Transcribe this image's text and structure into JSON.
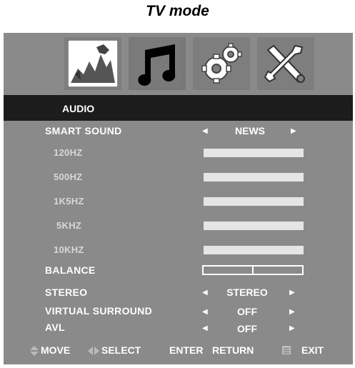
{
  "page_title": "TV mode",
  "tabs": [
    {
      "name": "picture",
      "icon": "picture-icon"
    },
    {
      "name": "audio",
      "icon": "music-note-icon"
    },
    {
      "name": "setup",
      "icon": "gears-icon"
    },
    {
      "name": "tools",
      "icon": "tools-icon"
    }
  ],
  "header": "AUDIO",
  "rows": {
    "smart_sound": {
      "label": "SMART SOUND",
      "value": "NEWS"
    },
    "eq": [
      {
        "label": "120HZ"
      },
      {
        "label": "500HZ"
      },
      {
        "label": "1K5HZ"
      },
      {
        "label": "5KHZ"
      },
      {
        "label": "10KHZ"
      }
    ],
    "balance": {
      "label": "BALANCE"
    },
    "stereo": {
      "label": "STEREO",
      "value": "STEREO"
    },
    "virtual_surround": {
      "label": "VIRTUAL SURROUND",
      "value": "OFF"
    },
    "avl": {
      "label": "AVL",
      "value": "OFF"
    }
  },
  "footer": {
    "move": "MOVE",
    "select": "SELECT",
    "enter_key": "ENTER",
    "return": "RETURN",
    "exit": "EXIT"
  },
  "colors": {
    "panel": "#8a8a8a",
    "header": "#1c1c1c",
    "bar": "#e5e5e5"
  }
}
